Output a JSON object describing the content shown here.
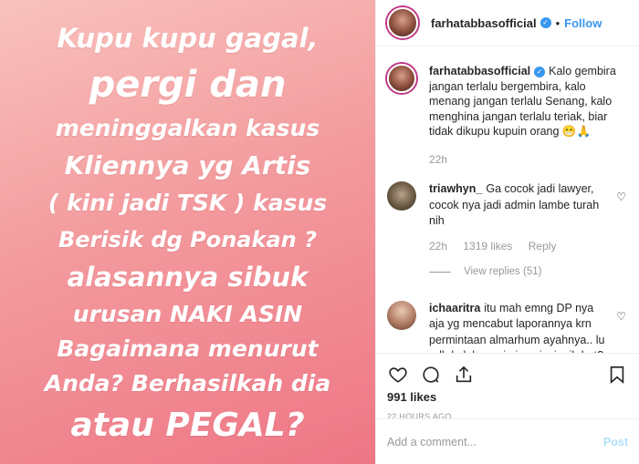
{
  "post_image": {
    "lines": [
      "Kupu kupu gagal,",
      "pergi dan",
      "meninggalkan kasus",
      "Kliennya yg Artis",
      "( kini jadi TSK ) kasus",
      "Berisik dg Ponakan ?",
      "alasannya sibuk",
      "urusan NAKI ASIN",
      "Bagaimana menurut",
      "Anda? Berhasilkah dia",
      "atau PEGAL?"
    ]
  },
  "header": {
    "username": "farhatabbasofficial",
    "verified_icon": "✓",
    "separator": "•",
    "follow_label": "Follow"
  },
  "caption": {
    "username": "farhatabbasofficial",
    "verified_icon": "✓",
    "text": "Kalo gembira jangan terlalu bergembira, kalo menang jangan terlalu Senang, kalo menghina jangan terlalu teriak, biar tidak dikupu kupuin orang 😁🙏",
    "time": "22h"
  },
  "comments": [
    {
      "username": "triawhyn_",
      "text": "Ga cocok jadi lawyer, cocok nya jadi admin lambe turah nih",
      "time": "22h",
      "likes": "1319 likes",
      "reply": "Reply",
      "view_replies": "View replies (51)"
    },
    {
      "username": "ichaaritra",
      "text": "itu mah emng DP nya aja yg mencabut laporannya krn permintaan almarhum ayahnya.. lu udh kalah masi aja nyinyir sih hat? udah akuin aja diatas langit"
    }
  ],
  "actions": {
    "likes": "991 likes",
    "timestamp": "22 HOURS AGO",
    "comment_placeholder": "Add a comment...",
    "post_label": "Post"
  },
  "colors": {
    "accent": "#3897f0",
    "post_disabled": "#b2dffc",
    "muted": "#999999",
    "gradient_top": "#f9c2bd",
    "gradient_bottom": "#ee7685"
  }
}
